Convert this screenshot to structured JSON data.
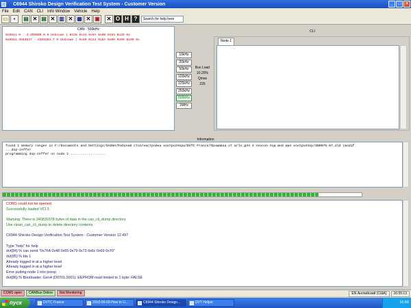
{
  "window": {
    "title": "C6944 Shiroko Design Verification Test System - Customer Version"
  },
  "menu": [
    "File",
    "Edit",
    "CAN",
    "CLI",
    "Info Window",
    "Vehicle",
    "Help"
  ],
  "toolbar": {
    "help_placeholder": "Search for help here"
  },
  "can_panel": {
    "title": "CAN - 500kHz",
    "messages": [
      "0x0611        0  - d-359009.0  0  Unknown  ( 0x28 0x24 0x5A 0x00 0x93 0x20 0x",
      "0x0581  3593837  - d359283.7  0  Unknown  ( 0x60 0x24 0x5A 0x00 0x00 0x00 0x"
    ],
    "speeds": [
      "10kHz",
      "20kHz",
      "50kHz",
      "100kHz",
      "125kHz",
      "250kHz",
      "500kHz",
      "1MHz"
    ],
    "selected_speed": "500kHz",
    "busload_label": "Bus Load",
    "busload_value": "10.20%",
    "qmax_label": "Qmax",
    "qmax_value": "226"
  },
  "cli_panel": {
    "title": "CLI",
    "tab": "Node 1"
  },
  "info_panel": {
    "title": "Information",
    "lines": [
      "found 1 memory ranges in F:/Documents and Settings/SASHA/Рабочий стол/настройка контроллера/DVTC France/Прошивка от arlo для 4 sevcon под мой мал контроллер/SN0076.07.dld (modif",
      "        ...dsp-zeffer",
      "programming dsp-zeffer on node 1      .................."
    ],
    "progress_percent": 88
  },
  "console": {
    "lines": [
      {
        "text": "COM1 could not be opened",
        "kind": "err"
      },
      {
        "text": "Successfully loaded VCI 3.",
        "kind": "ok"
      },
      {
        "text": "",
        "kind": "ok"
      },
      {
        "text": "Warning: There is 340830378 bytes of data in the can_cli_dump directory.",
        "kind": "warn"
      },
      {
        "text": "        Use clean_can_cli_dump to delete directory contents.",
        "kind": "warn"
      },
      {
        "text": "",
        "kind": "norm"
      },
      {
        "text": "C6944 Shiroko Design Verification Test System - Customer Version 12.497",
        "kind": "norm"
      },
      {
        "text": "",
        "kind": "norm"
      },
      {
        "text": "Type \"help\" for help",
        "kind": "norm"
      },
      {
        "text": "dvt(84) % can send \"0x7FA 0x48 0x65 0x79 0x73 0x6c 0x69 0x70\"",
        "kind": "norm"
      },
      {
        "text": "dvt(85) % bts 1",
        "kind": "norm"
      },
      {
        "text": "Already logged in at a higher level",
        "kind": "norm"
      },
      {
        "text": "Already logged in at a higher level",
        "kind": "norm"
      },
      {
        "text": "Error putting node 1 into preop",
        "kind": "norm"
      },
      {
        "text": "dvt(86) % Bootloader: Gen4 (D0701.0001). EEPROM read limited to 1 byte: FALSE",
        "kind": "norm"
      }
    ]
  },
  "status": {
    "com": "COM1 open",
    "canbus": "CANBus Online",
    "monitor": "Not Monitoring",
    "language": "EN Английский (США)",
    "time": "16:55:13"
  },
  "taskbar": {
    "start": "пуск",
    "tasks": [
      "DVTC France",
      "2010-06-03-How to U...",
      "C6944 Shiroko Design...",
      "DVT Helper"
    ],
    "active_task": 2,
    "clock": "16:55"
  }
}
